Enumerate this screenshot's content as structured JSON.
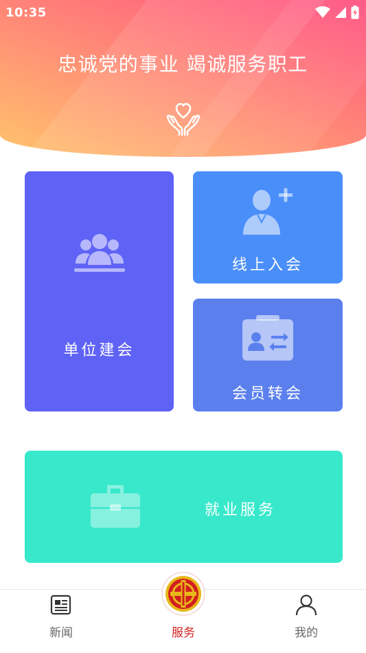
{
  "status_bar": {
    "time": "10:35",
    "icons": [
      "wifi-icon",
      "signal-icon",
      "battery-charging-icon"
    ]
  },
  "header": {
    "slogan": "忠诚党的事业 竭诚服务职工",
    "emblem_icon": "heart-in-hands-icon",
    "gradient": [
      "#ffc46b",
      "#ff8f76",
      "#ff4e7f"
    ]
  },
  "tiles": {
    "unit": {
      "label": "单位建会",
      "icon": "group-of-people-icon",
      "color": "#5f63f5"
    },
    "online_join": {
      "label": "线上入会",
      "icon": "add-user-icon",
      "color": "#4a8ef9"
    },
    "transfer": {
      "label": "会员转会",
      "icon": "id-card-transfer-icon",
      "color": "#5b80ee"
    },
    "employment": {
      "label": "就业服务",
      "icon": "briefcase-icon",
      "color": "#38e8cb"
    }
  },
  "bottom_nav": {
    "items": [
      {
        "label": "新闻",
        "icon": "newspaper-icon",
        "active": false
      },
      {
        "label": "服务",
        "icon": "trade-union-emblem-icon",
        "active": true
      },
      {
        "label": "我的",
        "icon": "person-icon",
        "active": false
      }
    ],
    "active_color": "#d2201f",
    "inactive_color": "#666666"
  }
}
